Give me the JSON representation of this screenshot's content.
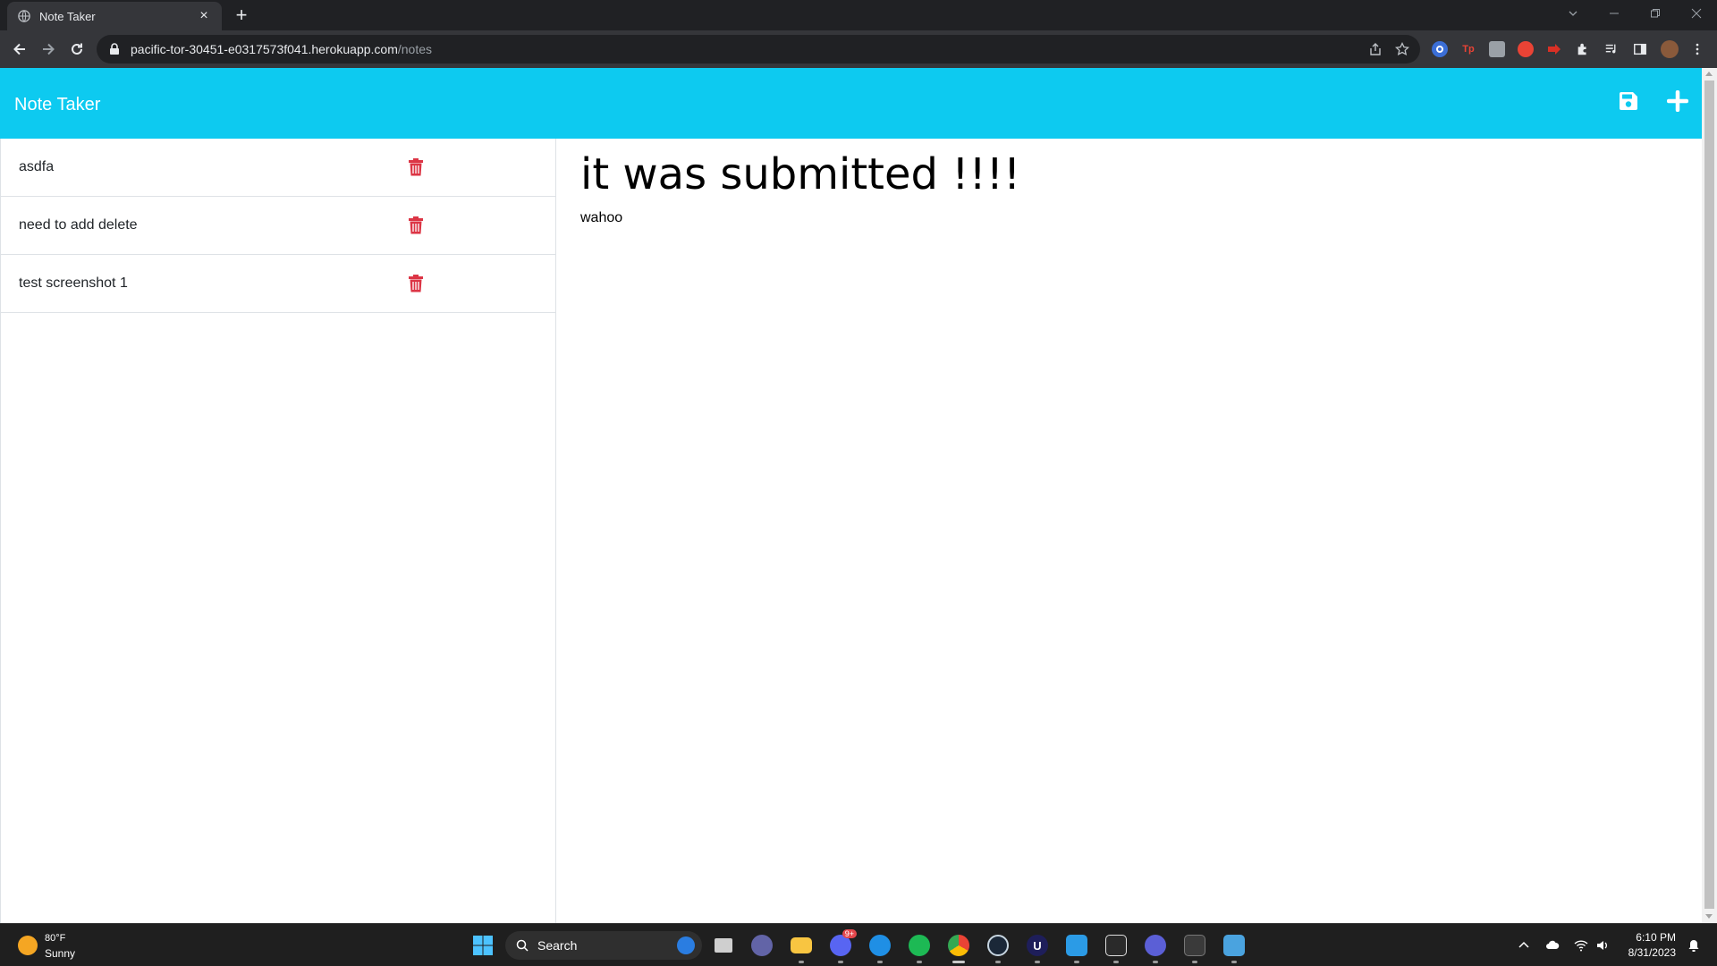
{
  "browser": {
    "tab_title": "Note Taker",
    "url_host": "pacific-tor-30451-e0317573f041.herokuapp.com",
    "url_path": "/notes",
    "extensions": [
      {
        "icon": "google-lens-icon",
        "text": "",
        "color": "#8ab4f8"
      },
      {
        "icon": "tp-extension-icon",
        "text": "Tp",
        "color": "#ea4335"
      },
      {
        "icon": "grey-extension-icon",
        "text": "",
        "color": "#9aa0a6"
      },
      {
        "icon": "red-shield-extension-icon",
        "text": "",
        "color": "#ea4335"
      },
      {
        "icon": "red-arrow-extension-icon",
        "text": "",
        "color": "#d93025"
      }
    ]
  },
  "app": {
    "title": "Note Taker",
    "notes": [
      {
        "title": "asdfa"
      },
      {
        "title": "need to add delete"
      },
      {
        "title": "test screenshot 1"
      }
    ],
    "active_note": {
      "title": "it was submitted !!!!",
      "text": "wahoo"
    },
    "accent_color": "#0dcaf0",
    "delete_color": "#dc3545"
  },
  "taskbar": {
    "weather": {
      "temp": "80°F",
      "desc": "Sunny"
    },
    "search_label": "Search",
    "time": "6:10 PM",
    "date": "8/31/2023",
    "apps": [
      {
        "name": "task-view-app",
        "color": "#cfcfcf"
      },
      {
        "name": "teams-app",
        "color": "#6264a7"
      },
      {
        "name": "file-explorer-app",
        "color": "#f8c541"
      },
      {
        "name": "discord-app",
        "color": "#5865f2"
      },
      {
        "name": "azure-data-studio-app",
        "color": "#1f8fe5"
      },
      {
        "name": "spotify-app",
        "color": "#1db954"
      },
      {
        "name": "chrome-app",
        "color": "#e8453c"
      },
      {
        "name": "steam-app",
        "color": "#1b2838"
      },
      {
        "name": "unreal-app",
        "color": "#1e1e5a"
      },
      {
        "name": "vscode-app",
        "color": "#2b9be6"
      },
      {
        "name": "epic-games-app",
        "color": "#2a2a2a"
      },
      {
        "name": "obs-app",
        "color": "#5b5fd6"
      },
      {
        "name": "terminal-app",
        "color": "#3a3a3a"
      },
      {
        "name": "monitor-app",
        "color": "#4aa3df"
      }
    ],
    "discord_badge": "9+"
  }
}
